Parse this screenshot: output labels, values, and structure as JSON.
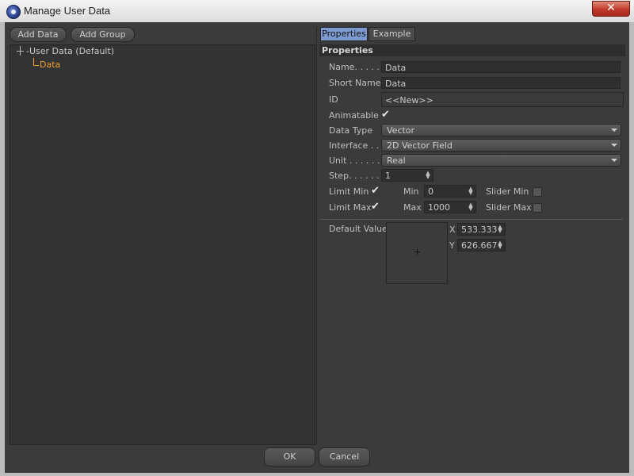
{
  "window": {
    "title": "Manage User Data",
    "close_label": "✕"
  },
  "left": {
    "add_data_label": "Add Data",
    "add_group_label": "Add Group",
    "tree": {
      "root_label": "-User Data (Default)",
      "child_label": "Data"
    }
  },
  "tabs": [
    {
      "label": "Properties",
      "active": true
    },
    {
      "label": "Example",
      "active": false
    }
  ],
  "properties": {
    "header": "Properties",
    "name_label": "Name. . . . .",
    "name_value": "Data",
    "short_name_label": "Short Name",
    "short_name_value": "Data",
    "id_label": "ID",
    "id_value": "<<New>>",
    "animatable_label": "Animatable",
    "animatable_checked": true,
    "data_type_label": "Data Type",
    "data_type_value": "Vector",
    "interface_label": "Interface . .",
    "interface_value": "2D Vector Field",
    "unit_label": "Unit . . . . . .",
    "unit_value": "Real",
    "step_label": "Step. . . . . .",
    "step_value": "1",
    "limit_min_label": "Limit Min",
    "limit_min_checked": true,
    "min_label": "Min",
    "min_value": "0",
    "slider_min_label": "Slider Min",
    "slider_min_checked": false,
    "limit_max_label": "Limit Max",
    "limit_max_checked": true,
    "max_label": "Max",
    "max_value": "1000",
    "slider_max_label": "Slider Max",
    "slider_max_checked": false,
    "default_value_label": "Default Value",
    "x_label": "X",
    "x_value": "533.333",
    "y_label": "Y",
    "y_value": "626.667"
  },
  "footer": {
    "ok_label": "OK",
    "cancel_label": "Cancel"
  },
  "colors": {
    "accent_tab": "#7d9bd0",
    "tree_selected": "#f0a030",
    "close_button": "#c0392b",
    "panel_bg": "#3b3b3b"
  }
}
